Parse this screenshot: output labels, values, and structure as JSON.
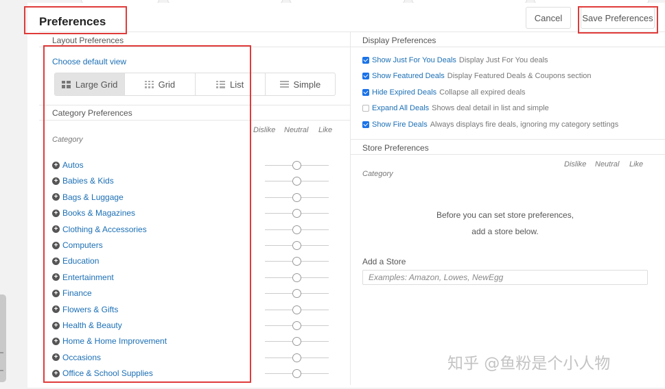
{
  "modal": {
    "title": "Preferences",
    "cancel_label": "Cancel",
    "save_label": "Save Preferences"
  },
  "layout": {
    "header": "Layout Preferences",
    "choose_view": "Choose default view",
    "views": [
      {
        "label": "Large Grid",
        "icon": "large-grid-icon",
        "selected": true
      },
      {
        "label": "Grid",
        "icon": "grid-icon",
        "selected": false
      },
      {
        "label": "List",
        "icon": "list-icon",
        "selected": false
      },
      {
        "label": "Simple",
        "icon": "simple-icon",
        "selected": false
      }
    ]
  },
  "category_prefs": {
    "header": "Category Preferences",
    "col_category": "Category",
    "col_dislike": "Dislike",
    "col_neutral": "Neutral",
    "col_like": "Like",
    "items": [
      "Autos",
      "Babies & Kids",
      "Bags & Luggage",
      "Books & Magazines",
      "Clothing & Accessories",
      "Computers",
      "Education",
      "Entertainment",
      "Finance",
      "Flowers & Gifts",
      "Health & Beauty",
      "Home & Home Improvement",
      "Occasions",
      "Office & School Supplies"
    ],
    "slider_value": "neutral"
  },
  "display_prefs": {
    "header": "Display Preferences",
    "options": [
      {
        "label": "Show Just For You Deals",
        "desc": "Display Just For You deals",
        "checked": true
      },
      {
        "label": "Show Featured Deals",
        "desc": "Display Featured Deals & Coupons section",
        "checked": true
      },
      {
        "label": "Hide Expired Deals",
        "desc": "Collapse all expired deals",
        "checked": true
      },
      {
        "label": "Expand All Deals",
        "desc": "Shows deal detail in list and simple",
        "checked": false
      },
      {
        "label": "Show Fire Deals",
        "desc": "Always displays fire deals, ignoring my category settings",
        "checked": true
      }
    ]
  },
  "store_prefs": {
    "header": "Store Preferences",
    "col_category": "Category",
    "col_dislike": "Dislike",
    "col_neutral": "Neutral",
    "col_like": "Like",
    "empty_line1": "Before you can set store preferences,",
    "empty_line2": "add a store below.",
    "add_label": "Add a Store",
    "add_placeholder": "Examples: Amazon, Lowes, NewEgg"
  },
  "watermark": "知乎 @鱼粉是个小人物",
  "colors": {
    "link": "#1b6fb5",
    "checkbox": "#1a73e8",
    "highlight_box": "#e03a3a"
  }
}
